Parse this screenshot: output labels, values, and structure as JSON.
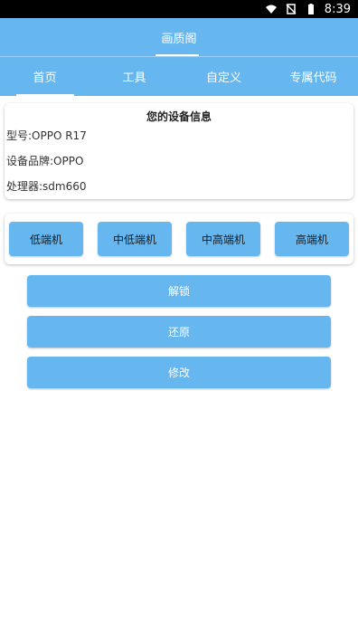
{
  "status": {
    "time": "8:39"
  },
  "app": {
    "title": "画质阁"
  },
  "tabs": [
    {
      "label": "首页",
      "active": true
    },
    {
      "label": "工具",
      "active": false
    },
    {
      "label": "自定义",
      "active": false
    },
    {
      "label": "专属代码",
      "active": false
    }
  ],
  "device": {
    "title": "您的设备信息",
    "model": "型号:OPPO R17",
    "brand": "设备品牌:OPPO",
    "processor": "处理器:sdm660"
  },
  "tiers": [
    "低端机",
    "中低端机",
    "中高端机",
    "高端机"
  ],
  "actions": [
    "解锁",
    "还原",
    "修改"
  ],
  "colors": {
    "accent": "#66b6f0",
    "statusbar": "#000000"
  },
  "icons": [
    "wifi-icon",
    "sim-off-icon",
    "battery-icon"
  ]
}
